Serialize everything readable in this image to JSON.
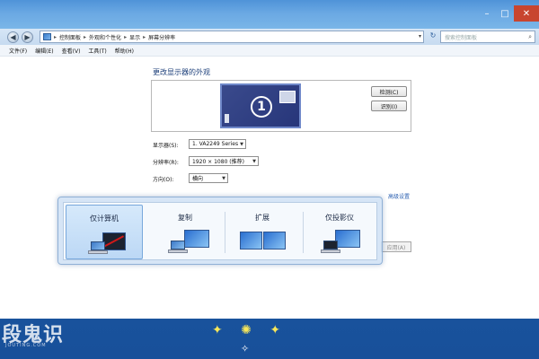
{
  "window": {
    "controls": {
      "minimize": "–",
      "maximize": "□",
      "close": "✕"
    }
  },
  "navbar": {
    "back": "◀",
    "forward": "▶",
    "breadcrumb": [
      "控制面板",
      "外观和个性化",
      "显示",
      "屏幕分辨率"
    ],
    "search_placeholder": "搜索控制面板"
  },
  "menubar": [
    "文件(F)",
    "编辑(E)",
    "查看(V)",
    "工具(T)",
    "帮助(H)"
  ],
  "page": {
    "title": "更改显示器的外观",
    "monitor_number": "1",
    "detect_button": "检测(C)",
    "identify_button": "识别(I)",
    "display_label": "显示器(S):",
    "display_value": "1. VA2249 Series",
    "resolution_label": "分辨率(R):",
    "resolution_value": "1920 × 1080 (推荐)",
    "orientation_label": "方向(O):",
    "orientation_value": "横向",
    "advanced_link": "高级设置",
    "apply_button": "应用(A)"
  },
  "switcher": {
    "selected": "仅计算机",
    "options": [
      "仅计算机",
      "复制",
      "扩展",
      "仅投影仪"
    ]
  },
  "watermark": {
    "text": "段鬼识",
    "sub": "JOUTING.COM"
  },
  "colors": {
    "accent": "#2a5fb0",
    "title_blue": "#1c3f7a",
    "desktop": "#1b57a1"
  }
}
